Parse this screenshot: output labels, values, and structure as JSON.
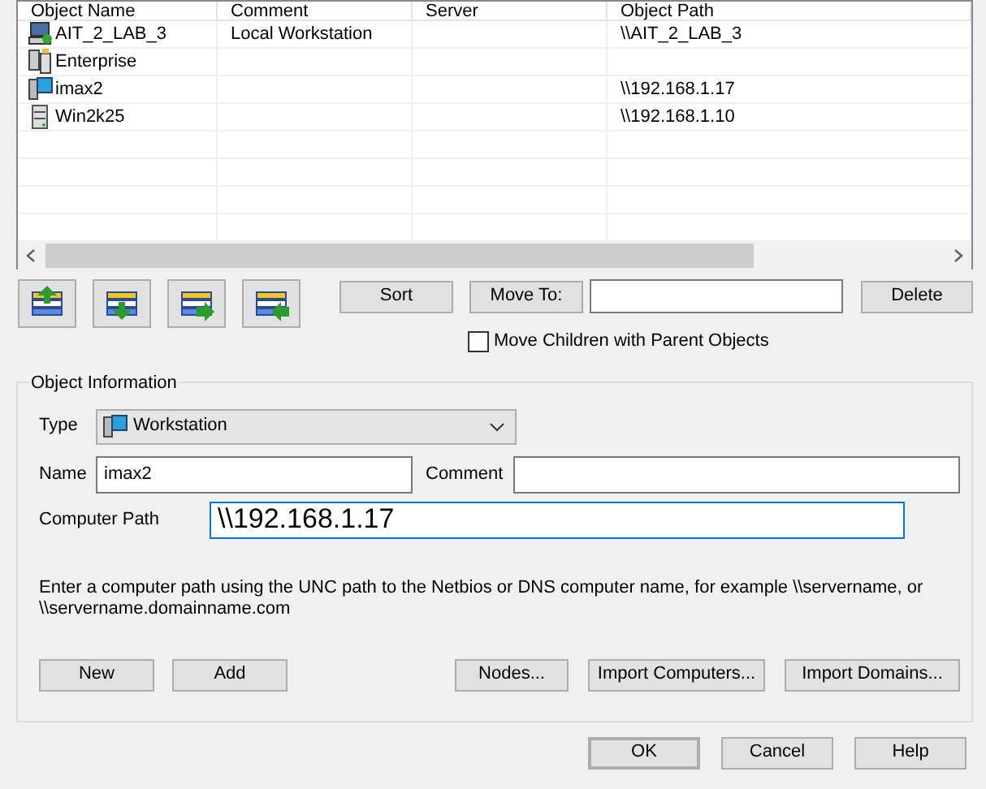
{
  "table": {
    "columns": [
      "Object Name",
      "Comment",
      "Server",
      "Object Path"
    ],
    "rows": [
      {
        "kind": "local",
        "cells": [
          "AIT_2_LAB_3",
          "Local Workstation",
          "",
          "\\\\AIT_2_LAB_3"
        ]
      },
      {
        "kind": "enterprise",
        "cells": [
          "Enterprise",
          "",
          "",
          ""
        ]
      },
      {
        "kind": "workstation",
        "cells": [
          "imax2",
          "",
          "",
          "\\\\192.168.1.17"
        ]
      },
      {
        "kind": "server",
        "cells": [
          "Win2k25",
          "",
          "",
          "\\\\192.168.1.10"
        ]
      }
    ]
  },
  "toolbar": {
    "sort": "Sort",
    "move_to": "Move To:",
    "delete": "Delete",
    "move_children": {
      "label": "Move Children with Parent Objects",
      "checked": false
    }
  },
  "object_information": {
    "title": "Object Information",
    "type_label": "Type",
    "type_value": "Workstation",
    "name_label": "Name",
    "name_value": "imax2",
    "comment_label": "Comment",
    "path_label": "Computer Path",
    "path_value": "\\\\192.168.1.17",
    "help_text": "Enter a computer path using the UNC path to the Netbios or DNS computer name, for example \\\\servername, or \\\\servername.domainname.com",
    "buttons": [
      "New",
      "Add",
      "Nodes...",
      "Import Computers...",
      "Import Domains..."
    ]
  },
  "dialog_buttons": [
    {
      "label": "OK",
      "default": true
    },
    {
      "label": "Cancel",
      "default": false
    },
    {
      "label": "Help",
      "default": false
    }
  ]
}
